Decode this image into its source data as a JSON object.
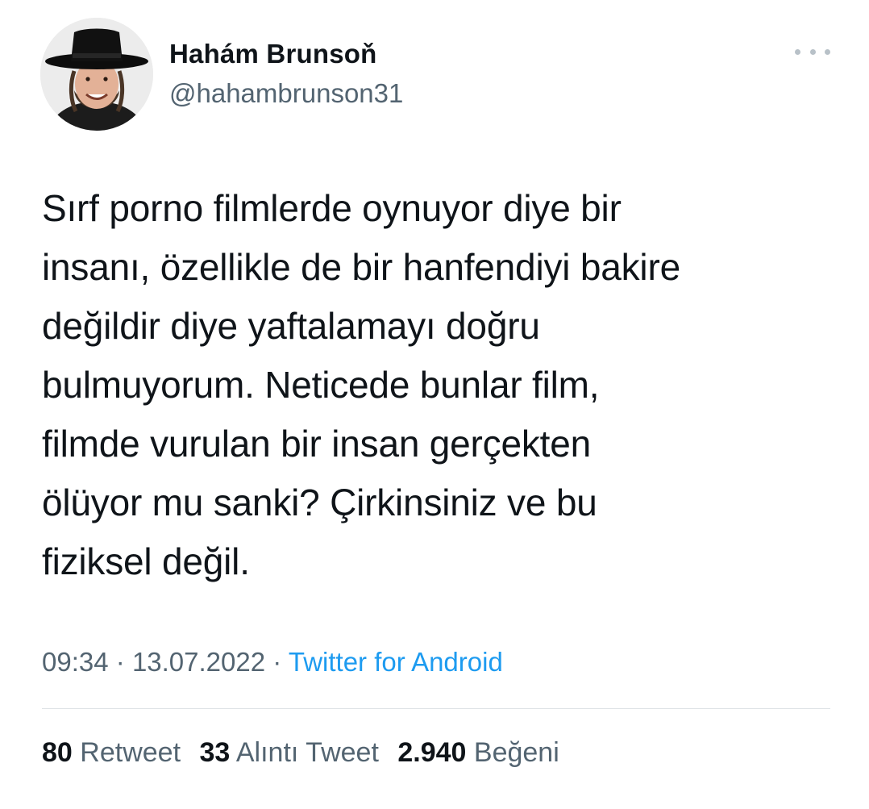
{
  "author": {
    "display_name": "Hahám Brunsoň",
    "handle": "@hahambrunson31",
    "avatar_icon": "profile-photo"
  },
  "more_icon": "more-options-icon",
  "tweet": {
    "text": "Sırf porno filmlerde oynuyor diye bir\ninsanı, özellikle de bir hanfendiyi bakire\ndeğildir diye yaftalamayı doğru\nbulmuyorum. Neticede bunlar film,\nfilmde vurulan bir insan gerçekten\nölüyor mu sanki? Çirkinsiniz ve bu\nfiziksel değil.",
    "time": "09:34",
    "date": "13.07.2022",
    "separator": "·",
    "source": "Twitter for Android"
  },
  "stats": {
    "retweets_count": "80",
    "retweets_label": "Retweet",
    "quotes_count": "33",
    "quotes_label": "Alıntı Tweet",
    "likes_count": "2.940",
    "likes_label": "Beğeni"
  },
  "colors": {
    "text": "#0f1419",
    "secondary": "#536471",
    "link": "#1d9bf0",
    "divider": "#dfe3e6"
  }
}
